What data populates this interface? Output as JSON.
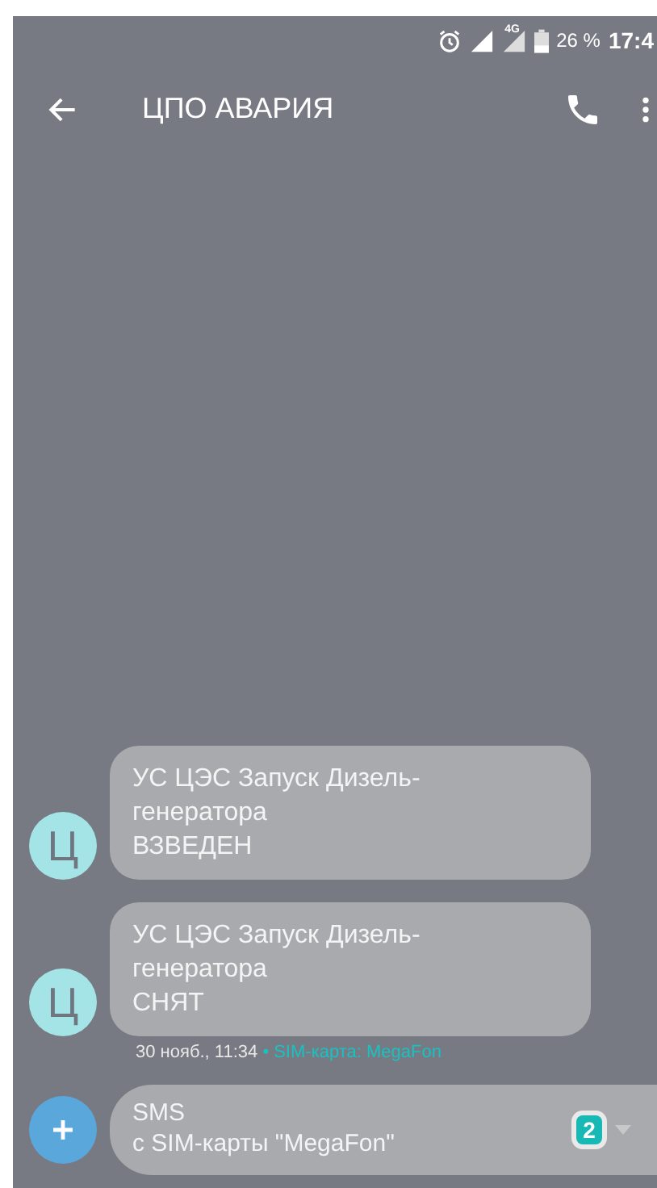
{
  "status_bar": {
    "battery": "26 %",
    "time": "17:4",
    "network": "4G"
  },
  "toolbar": {
    "title": "ЦПО АВАРИЯ"
  },
  "messages": [
    {
      "avatar": "Ц",
      "text": "УС ЦЭС Запуск Дизель-\nгенератора\nВЗВЕДЕН"
    },
    {
      "avatar": "Ц",
      "text": "УС ЦЭС Запуск Дизель-\nгенератора\nСНЯТ",
      "date": "30 нояб., 11:34",
      "sim": "• SIM-карта: MegaFon"
    }
  ],
  "composer": {
    "placeholder": "SMS\nс SIM-карты \"MegaFon\"",
    "sim_badge": "2"
  }
}
